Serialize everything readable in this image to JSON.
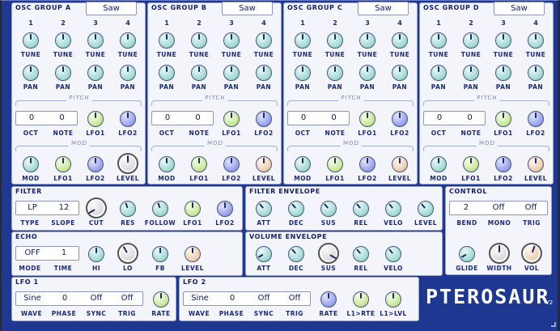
{
  "osc_groups": [
    {
      "title": "OSC GROUP A",
      "wave": "Saw",
      "oct": "0",
      "note": "0"
    },
    {
      "title": "OSC GROUP B",
      "wave": "Saw",
      "oct": "0",
      "note": "0"
    },
    {
      "title": "OSC GROUP C",
      "wave": "Saw",
      "oct": "0",
      "note": "0"
    },
    {
      "title": "OSC GROUP D",
      "wave": "Saw",
      "oct": "0",
      "note": "0"
    }
  ],
  "osc_labels": {
    "nums": [
      "1",
      "2",
      "3",
      "4"
    ],
    "tune": "TUNE",
    "pan": "PAN",
    "pitch": "PITCH",
    "mod": "MOD",
    "oct": "OCT",
    "note": "NOTE",
    "lfo1": "LFO1",
    "lfo2": "LFO2",
    "level": "LEVEL"
  },
  "filter": {
    "title": "FILTER",
    "type": "LP",
    "slope": "12",
    "labels": [
      "TYPE",
      "SLOPE",
      "CUT",
      "RES",
      "FOLLOW",
      "LFO1",
      "LFO2"
    ]
  },
  "filter_env": {
    "title": "FILTER ENVELOPE",
    "labels": [
      "ATT",
      "DEC",
      "SUS",
      "REL",
      "VELO",
      "LEVEL"
    ]
  },
  "control": {
    "title": "CONTROL",
    "bend": "2",
    "mono": "Off",
    "trig": "Off",
    "labels": [
      "BEND",
      "MONO",
      "TRIG",
      "GLIDE",
      "WIDTH",
      "VOL"
    ]
  },
  "echo": {
    "title": "ECHO",
    "mode": "OFF",
    "time": "1",
    "labels": [
      "MODE",
      "TIME",
      "HI",
      "LO",
      "FB",
      "LEVEL"
    ]
  },
  "volume_env": {
    "title": "VOLUME ENVELOPE",
    "labels": [
      "ATT",
      "DEC",
      "SUS",
      "REL",
      "VELO"
    ]
  },
  "lfo1": {
    "title": "LFO 1",
    "wave": "Sine",
    "phase": "0",
    "sync": "Off",
    "trig": "Off",
    "labels": [
      "WAVE",
      "PHASE",
      "SYNC",
      "TRIG",
      "RATE"
    ]
  },
  "lfo2": {
    "title": "LFO 2",
    "wave": "Sine",
    "phase": "0",
    "sync": "Off",
    "trig": "Off",
    "labels": [
      "WAVE",
      "PHASE",
      "SYNC",
      "TRIG",
      "RATE",
      "L1>RTE",
      "L1>LVL"
    ]
  },
  "brand": {
    "logo": "PTEROSAUR",
    "version": "V2"
  },
  "colors": {
    "background": "#1e3791",
    "panel": "#f4f5fb",
    "knob_teal": "#a8ddd6",
    "knob_green": "#cde9a0",
    "knob_blue": "#9ea8ee",
    "knob_peach": "#ecd3b6"
  }
}
